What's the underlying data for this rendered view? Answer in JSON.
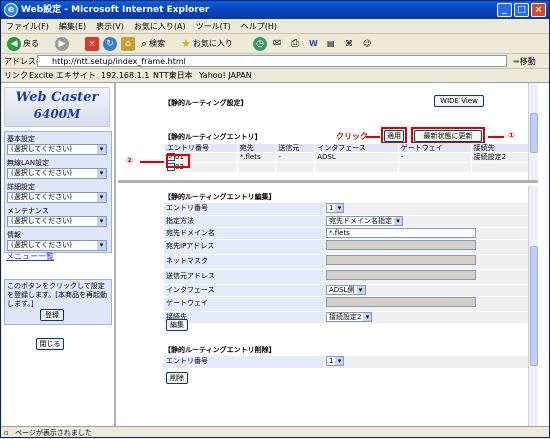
{
  "window": {
    "title": "Web設定 - Microsoft Internet Explorer"
  },
  "menu": [
    "ファイル(F)",
    "編集(E)",
    "表示(V)",
    "お気に入り(A)",
    "ツール(T)",
    "ヘルプ(H)"
  ],
  "toolbar": {
    "back": "戻る",
    "search": "検索",
    "favorites": "お気に入り"
  },
  "address": {
    "label": "アドレス(D)",
    "value": "http://ntt.setup/index_frame.html",
    "go": "移動"
  },
  "links": {
    "label": "リンク",
    "items": [
      "Excite エキサイト",
      "192.168.1.1",
      "NTT東日本",
      "Yahoo! JAPAN"
    ]
  },
  "logo": {
    "line1": "Web Caster",
    "line2": "6400M"
  },
  "nav": {
    "groups": [
      {
        "label": "基本設定",
        "select": "(選択してください)"
      },
      {
        "label": "無線LAN設定",
        "select": "(選択してください)"
      },
      {
        "label": "詳細設定",
        "select": "(選択してください)"
      },
      {
        "label": "メンテナンス",
        "select": "(選択してください)"
      },
      {
        "label": "情報",
        "select": "(選択してください)"
      }
    ],
    "menu_link": "メニュー一覧"
  },
  "info": {
    "text": "このボタンをクリックして設定を登録します。[本商品を再起動します。]",
    "register": "登録",
    "close": "閉じる"
  },
  "top": {
    "title": "【静的ルーティング設定】",
    "wide_view": "WIDE View",
    "entry_title": "【静的ルーティングエントリ】",
    "apply": "適用",
    "refresh": "最新状態に更新",
    "columns": [
      "エントリ番号",
      "宛先",
      "送信元",
      "インタフェース",
      "ゲートウェイ",
      "接続先"
    ],
    "rows": [
      [
        "01",
        "*.flets",
        "-",
        "ADSL",
        "-",
        "接続設定2"
      ],
      [
        "02",
        "",
        "",
        "",
        "",
        ""
      ]
    ]
  },
  "annotations": {
    "click": "クリック",
    "one": "①",
    "two": "②"
  },
  "edit": {
    "title": "【静的ルーティングエントリ編集】",
    "fields": [
      {
        "label": "エントリ番号",
        "type": "select",
        "value": "1"
      },
      {
        "label": "指定方法",
        "type": "select",
        "value": "宛先ドメイン名指定"
      },
      {
        "label": "宛先ドメイン名",
        "type": "text",
        "value": "*.flets"
      },
      {
        "label": "宛先IPアドレス",
        "type": "disabled",
        "value": ""
      },
      {
        "label": "ネットマスク",
        "type": "disabled",
        "value": ""
      },
      {
        "label": "送信元アドレス",
        "type": "disabled",
        "value": ""
      },
      {
        "label": "インタフェース",
        "type": "select",
        "value": "ADSL側"
      },
      {
        "label": "ゲートウェイ",
        "type": "disabled",
        "value": ""
      },
      {
        "label": "接続先",
        "type": "select",
        "value": "接続設定2"
      }
    ],
    "button": "編集"
  },
  "del": {
    "title": "【静的ルーティングエントリ削除】",
    "label": "エントリ番号",
    "value": "1",
    "button": "削除"
  },
  "status": "ページが表示されました"
}
